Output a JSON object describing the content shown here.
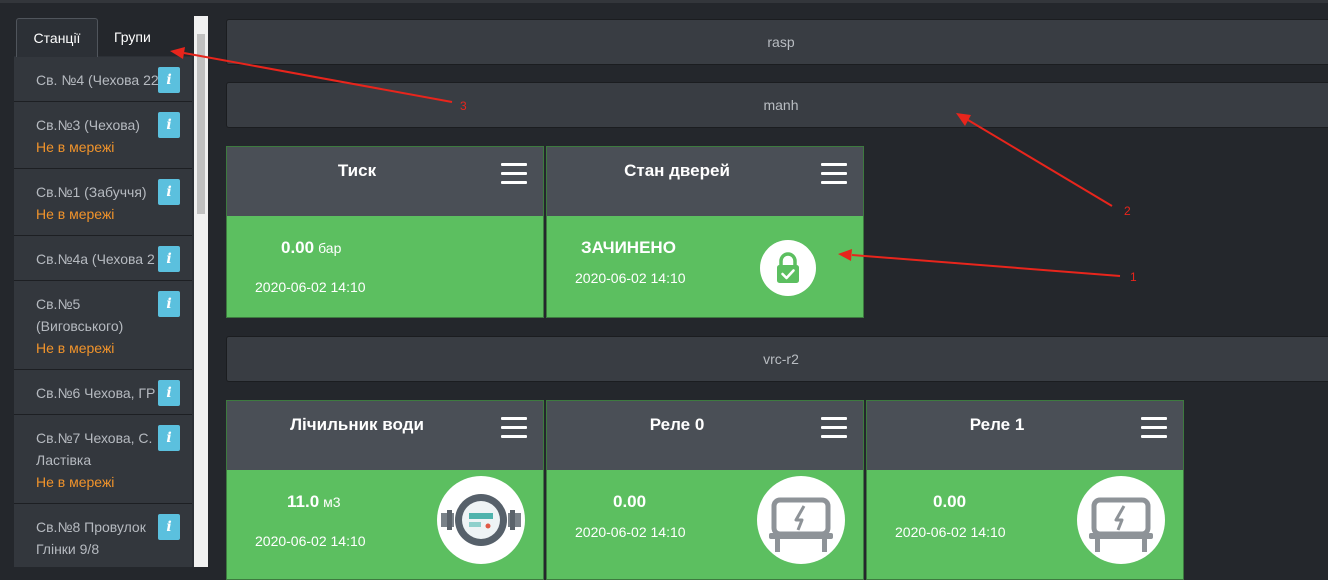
{
  "sidebar": {
    "tabs": [
      {
        "label": "Станції"
      },
      {
        "label": "Групи"
      }
    ],
    "stations": [
      {
        "name": "Св. №4 (Чехова 22)",
        "status": ""
      },
      {
        "name": "Св.№3 (Чехова)",
        "status": "Не в мережі"
      },
      {
        "name": "Св.№1 (Забуччя)",
        "status": "Не в мережі"
      },
      {
        "name": "Св.№4а (Чехова 2",
        "status": ""
      },
      {
        "name": "Св.№5 (Виговського)",
        "status": "Не в мережі"
      },
      {
        "name": "Св.№6 Чехова, ГР",
        "status": ""
      },
      {
        "name": "Св.№7 Чехова, С. Ластівка",
        "status": "Не в мережі"
      },
      {
        "name": "Св.№8 Провулок Глінки 9/8",
        "status": ""
      }
    ],
    "info_glyph": "i"
  },
  "groups": [
    {
      "label": "rasp"
    },
    {
      "label": "manh"
    },
    {
      "label": "vrc-r2"
    }
  ],
  "cards": {
    "pressure": {
      "title": "Тиск",
      "value": "0.00",
      "unit": "бар",
      "time": "2020-06-02 14:10"
    },
    "door": {
      "title": "Стан дверей",
      "state": "ЗАЧИНЕНО",
      "time": "2020-06-02 14:10",
      "icon": "lock-icon"
    },
    "water_meter": {
      "title": "Лічильник води",
      "value": "11.0",
      "unit": "м3",
      "time": "2020-06-02 14:10",
      "icon": "water-meter-icon"
    },
    "relay0": {
      "title": "Реле 0",
      "value": "0.00",
      "time": "2020-06-02 14:10",
      "icon": "relay-icon"
    },
    "relay1": {
      "title": "Реле 1",
      "value": "0.00",
      "time": "2020-06-02 14:10",
      "icon": "relay-icon"
    }
  },
  "annotations": {
    "label1": "1",
    "label2": "2",
    "label3": "3"
  },
  "colors": {
    "card_green": "#5cbf60",
    "offline_orange": "#f0932b",
    "info_blue": "#5bc0de",
    "annotation_red": "#e8251c"
  }
}
